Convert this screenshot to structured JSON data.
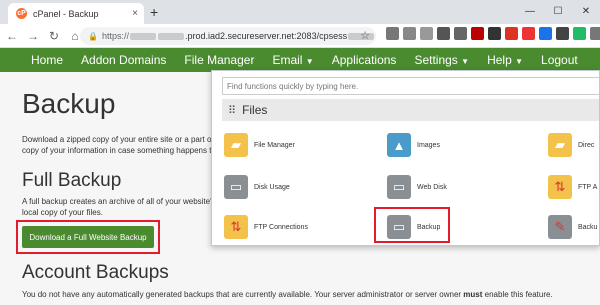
{
  "browser": {
    "tab_title": "cPanel - Backup",
    "tab_close": "×",
    "new_tab": "+",
    "favicon": "cP",
    "url_proto": "https://",
    "url_host": ".prod.iad2.secureserver.net:2083/cpsess",
    "win_min": "—",
    "win_max": "☐",
    "win_close": "✕"
  },
  "cpanel_nav": {
    "items": [
      "Home",
      "Addon Domains",
      "File Manager",
      "Email",
      "Applications",
      "Settings",
      "Help",
      "Logout"
    ]
  },
  "page": {
    "title": "Backup",
    "desc1": "Download a zipped copy of your entire site or a part o copy of your information in case something happens t",
    "full_backup_heading": "Full Backup",
    "desc2": "A full backup creates an archive of all of your website' local copy of your files.",
    "download_button": "Download a Full Website Backup",
    "account_backups_heading": "Account Backups",
    "desc3_pre": "You do not have any automatically generated backups that are currently available. Your server administrator or server owner ",
    "desc3_bold": "must",
    "desc3_post": " enable this feature."
  },
  "panel": {
    "search_placeholder": "Find functions quickly by typing here.",
    "section_title": "Files",
    "tools": [
      {
        "label": "File Manager",
        "icon": "folder-icon"
      },
      {
        "label": "Images",
        "icon": "image-icon"
      },
      {
        "label": "Direc",
        "icon": "folder-icon"
      },
      {
        "label": "Disk Usage",
        "icon": "disk-icon"
      },
      {
        "label": "Web Disk",
        "icon": "disk-icon"
      },
      {
        "label": "FTP A",
        "icon": "ftp-icon"
      },
      {
        "label": "FTP Connections",
        "icon": "ftp-connections-icon"
      },
      {
        "label": "Backup",
        "icon": "backup-icon"
      },
      {
        "label": "Backu",
        "icon": "backup-wizard-icon"
      }
    ]
  },
  "colors": {
    "cpanel_green": "#4a8b2f",
    "highlight_red": "#e11c2c"
  }
}
